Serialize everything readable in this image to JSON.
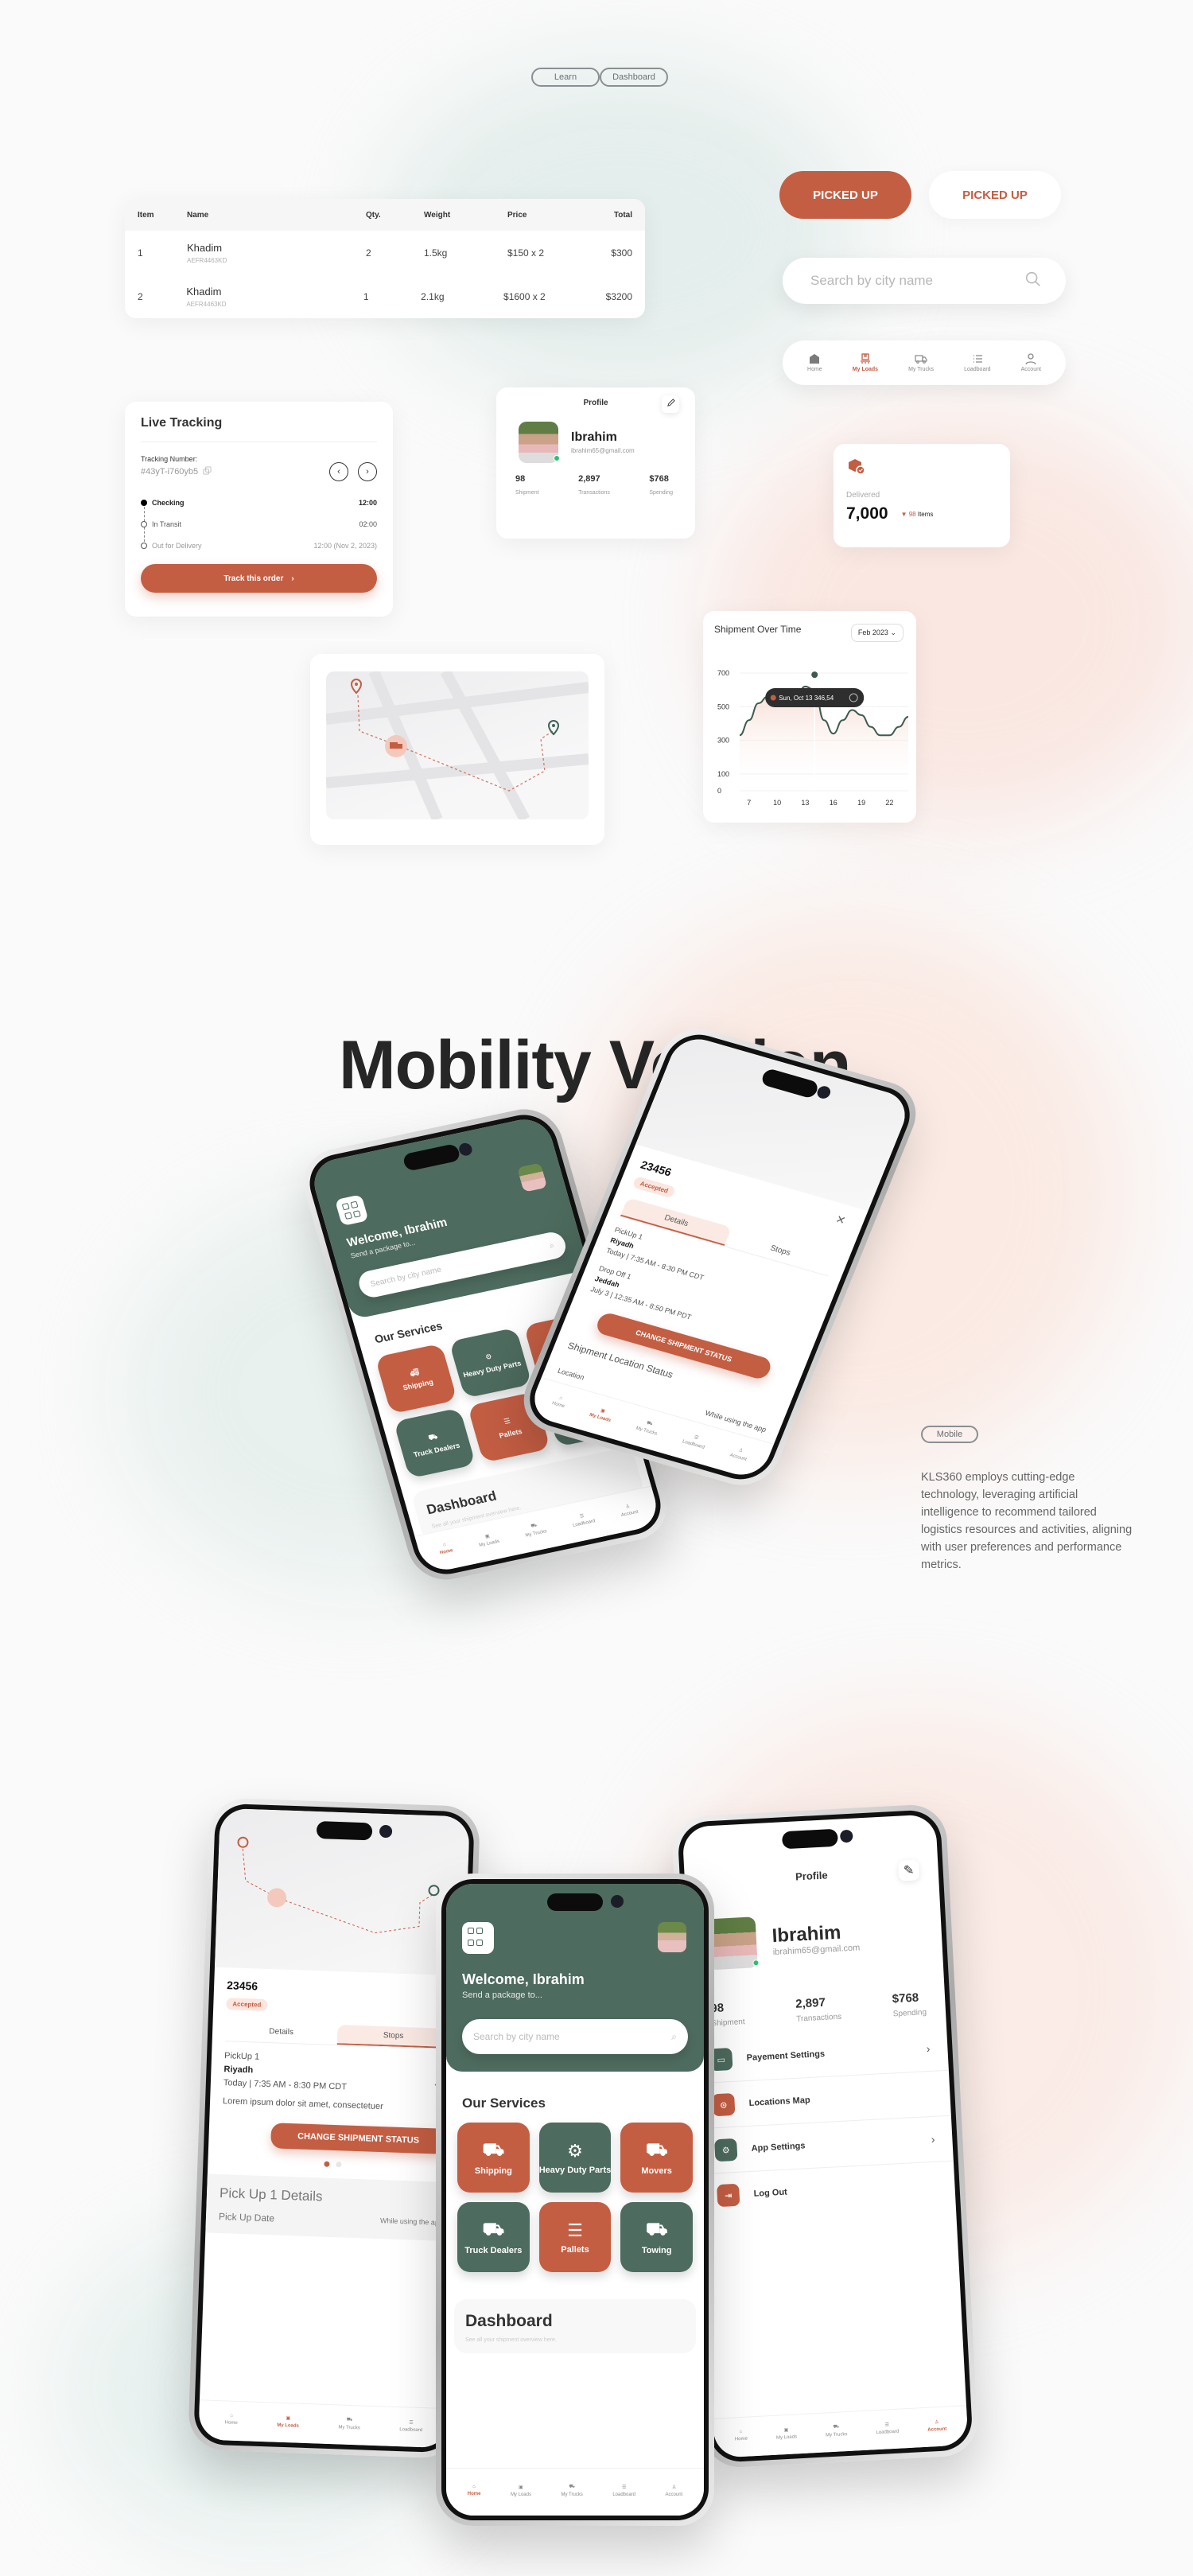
{
  "colors": {
    "accent": "#c45e43",
    "green": "#4d6b5e",
    "bg": "#fafafa"
  },
  "top_nav": {
    "learn": "Learn",
    "dashboard": "Dashboard"
  },
  "table": {
    "headers": [
      "Item",
      "Name",
      "Qty.",
      "Weight",
      "Price",
      "Total"
    ],
    "rows": [
      {
        "item": "1",
        "name": "Khadim",
        "sku": "AEFR4463KD",
        "qty": "2",
        "weight": "1.5kg",
        "price": "$150 x 2",
        "total": "$300"
      },
      {
        "item": "2",
        "name": "Khadim",
        "sku": "AEFR4463KD",
        "qty": "1",
        "weight": "2.1kg",
        "price": "$1600 x 2",
        "total": "$3200"
      }
    ]
  },
  "buttons": {
    "picked_up_primary": "PICKED UP",
    "picked_up_secondary": "PICKED UP"
  },
  "search": {
    "placeholder": "Search by city name",
    "icon": "search-icon"
  },
  "tabbar": {
    "items": [
      {
        "label": "Home",
        "icon": "home-icon"
      },
      {
        "label": "My Loads",
        "icon": "box-icon"
      },
      {
        "label": "My Trucks",
        "icon": "truck-icon"
      },
      {
        "label": "Loadboard",
        "icon": "list-icon"
      },
      {
        "label": "Account",
        "icon": "user-icon"
      }
    ],
    "active_top": "My Loads"
  },
  "live_tracking": {
    "title": "Live Tracking",
    "tracking_label": "Tracking Number:",
    "tracking_number": "#43yT-i760yb5",
    "steps": [
      {
        "label": "Checking",
        "time": "12:00"
      },
      {
        "label": "In Transit",
        "time": "02:00"
      },
      {
        "label": "Out for Delivery",
        "time": "12:00 (Nov 2, 2023)"
      }
    ],
    "button": "Track this order"
  },
  "profile": {
    "title": "Profile",
    "name": "Ibrahim",
    "email": "ibrahim65@gmail.com",
    "stats": [
      {
        "value": "98",
        "label": "Shipment"
      },
      {
        "value": "2,897",
        "label": "Transactions"
      },
      {
        "value": "$768",
        "label": "Spending"
      }
    ]
  },
  "delivered": {
    "label": "Delivered",
    "value": "7,000",
    "delta": "98",
    "delta_unit": "Items"
  },
  "chart_data": {
    "type": "line",
    "title": "Shipment Over Time",
    "period_select": "Feb 2023",
    "x": [
      6,
      7,
      8,
      9,
      10,
      11,
      12,
      13,
      14,
      15,
      16,
      17,
      18,
      19,
      20,
      21,
      22,
      23,
      24
    ],
    "xticks": [
      "7",
      "10",
      "13",
      "16",
      "19",
      "22"
    ],
    "yticks": [
      "0",
      "100",
      "300",
      "500",
      "700"
    ],
    "y_tick_values": [
      0,
      100,
      300,
      500,
      700
    ],
    "values": [
      330,
      420,
      520,
      560,
      540,
      520,
      560,
      620,
      600,
      420,
      340,
      420,
      480,
      450,
      380,
      330,
      330,
      380,
      440
    ],
    "ylim": [
      0,
      700
    ],
    "tooltip": {
      "date": "Sun, Oct 13",
      "value": "346,54",
      "x": 14
    },
    "grid": true
  },
  "hero": {
    "title": "Mobility Version",
    "tag": "Mobile",
    "description": "KLS360 employs cutting-edge technology, leveraging artificial intelligence to recommend tailored logistics resources and activities, aligning with user preferences and performance metrics."
  },
  "home_screen": {
    "welcome": "Welcome, Ibrahim",
    "subtitle": "Send a package to...",
    "search_placeholder": "Search by city name",
    "services_title": "Our Services",
    "services": [
      {
        "label": "Shipping",
        "color": "orange"
      },
      {
        "label": "Heavy Duty Parts",
        "color": "green"
      },
      {
        "label": "Movers",
        "color": "orange"
      },
      {
        "label": "Truck Dealers",
        "color": "green"
      },
      {
        "label": "Pallets",
        "color": "orange"
      },
      {
        "label": "Towing",
        "color": "green"
      }
    ],
    "dashboard_title": "Dashboard",
    "dashboard_sub": "See all your shipment overview here.",
    "active_tab": "Home"
  },
  "detail_screen": {
    "order_id": "23456",
    "status": "Accepted",
    "tabs": [
      "Details",
      "Stops"
    ],
    "pickup": {
      "label": "PickUp 1",
      "city": "Riyadh",
      "time": "Today | 7:35 AM - 8:30 PM CDT",
      "note": "Lorem ipsum dolor sit amet, consectetuer"
    },
    "dropoff": {
      "label": "Drop Off 1",
      "city": "Jeddah",
      "time": "July 3 | 12:35 AM - 8:50 PM PDT"
    },
    "button": "CHANGE SHIPMENT STATUS",
    "location_status": "Shipment Location Status",
    "location_label": "Location",
    "location_value": "While using the app",
    "pickup_details_title": "Pick Up 1 Details",
    "pickup_date_label": "Pick Up Date",
    "active_tab": "My Loads"
  },
  "profile_screen": {
    "title": "Profile",
    "menu": [
      {
        "label": "Payement Settings",
        "icon": "card-icon",
        "chevron": true
      },
      {
        "label": "Locations Map",
        "icon": "location-icon",
        "chevron": false
      },
      {
        "label": "App Settings",
        "icon": "gear-icon",
        "chevron": true
      },
      {
        "label": "Log Out",
        "icon": "logout-icon",
        "chevron": false
      }
    ],
    "active_tab": "Account"
  }
}
